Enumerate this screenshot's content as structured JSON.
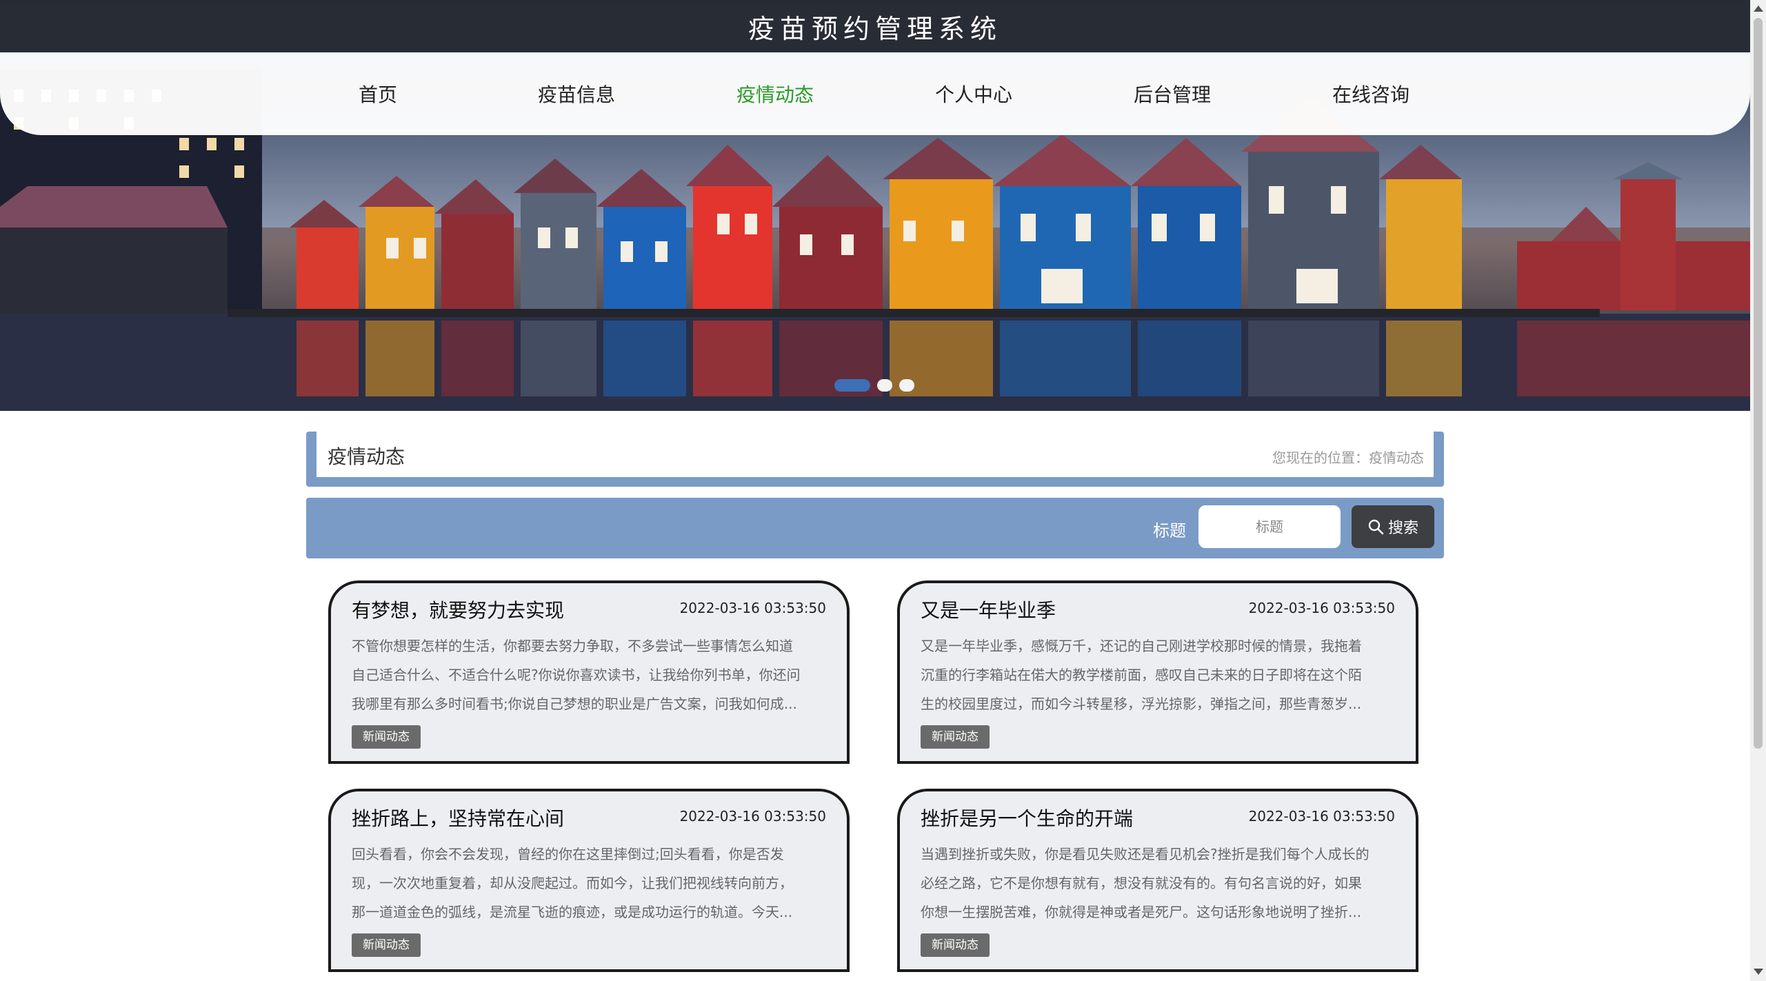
{
  "site": {
    "title": "疫苗预约管理系统"
  },
  "nav": {
    "items": [
      {
        "label": "首页"
      },
      {
        "label": "疫苗信息"
      },
      {
        "label": "疫情动态"
      },
      {
        "label": "个人中心"
      },
      {
        "label": "后台管理"
      },
      {
        "label": "在线咨询"
      }
    ],
    "active_index": 2,
    "active_color": "#2a9a2a"
  },
  "carousel": {
    "slide_count": 3,
    "active_index": 0
  },
  "breadcrumb": {
    "title": "疫情动态",
    "path": "您现在的位置：疫情动态"
  },
  "search": {
    "label": "标题",
    "placeholder": "标题",
    "value": "",
    "button_label": "搜索",
    "button_icon": "search-icon"
  },
  "colors": {
    "accent": "#7a9bc6",
    "topbar": "#282c34",
    "card_bg": "#eceef2",
    "tag_bg": "#6a6a6a"
  },
  "articles": [
    {
      "title": "有梦想，就要努力去实现",
      "date": "2022-03-16 03:53:50",
      "lines": [
        "不管你想要怎样的生活，你都要去努力争取，不多尝试一些事情怎么知道",
        "自己适合什么、不适合什么呢?你说你喜欢读书，让我给你列书单，你还问",
        "我哪里有那么多时间看书;你说自己梦想的职业是广告文案，问我如何成..."
      ],
      "tag": "新闻动态"
    },
    {
      "title": "又是一年毕业季",
      "date": "2022-03-16 03:53:50",
      "lines": [
        "又是一年毕业季，感慨万千，还记的自己刚进学校那时候的情景，我拖着",
        "沉重的行李箱站在偌大的教学楼前面，感叹自己未来的日子即将在这个陌",
        "生的校园里度过，而如今斗转星移，浮光掠影，弹指之间，那些青葱岁..."
      ],
      "tag": "新闻动态"
    },
    {
      "title": "挫折路上，坚持常在心间",
      "date": "2022-03-16 03:53:50",
      "lines": [
        "回头看看，你会不会发现，曾经的你在这里摔倒过;回头看看，你是否发",
        "现，一次次地重复着，却从没爬起过。而如今，让我们把视线转向前方，",
        "那一道道金色的弧线，是流星飞逝的痕迹，或是成功运行的轨道。今天..."
      ],
      "tag": "新闻动态"
    },
    {
      "title": "挫折是另一个生命的开端",
      "date": "2022-03-16 03:53:50",
      "lines": [
        "当遇到挫折或失败，你是看见失败还是看见机会?挫折是我们每个人成长的",
        "必经之路，它不是你想有就有，想没有就没有的。有句名言说的好，如果",
        "你想一生摆脱苦难，你就得是神或者是死尸。这句话形象地说明了挫折..."
      ],
      "tag": "新闻动态"
    }
  ]
}
